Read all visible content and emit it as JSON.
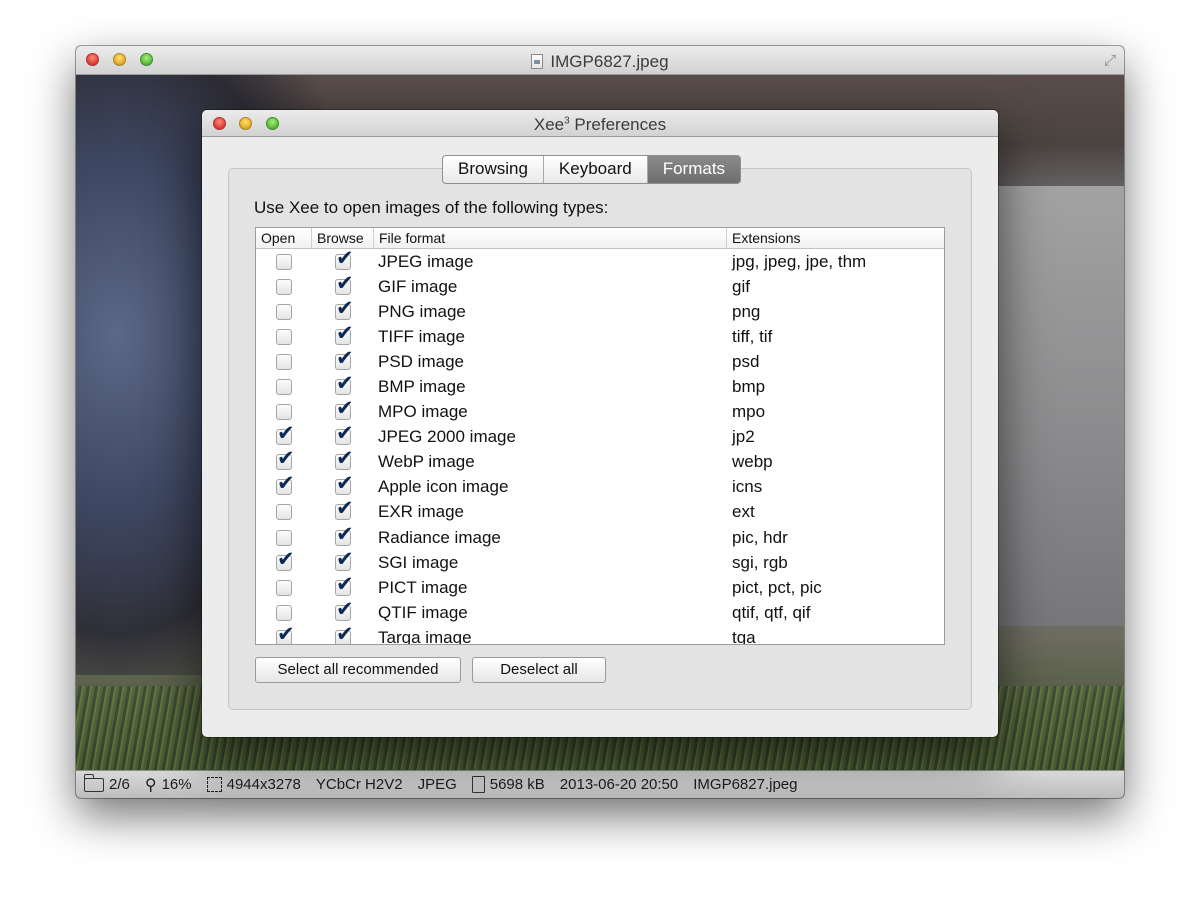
{
  "main_window": {
    "title": "IMGP6827.jpeg",
    "status": {
      "position": "2/6",
      "zoom": "16%",
      "dimensions": "4944x3278",
      "color_format": "YCbCr H2V2",
      "file_type": "JPEG",
      "file_size": "5698 kB",
      "date": "2013-06-20 20:50",
      "filename": "IMGP6827.jpeg"
    }
  },
  "prefs": {
    "title_main": "Xee",
    "title_sup": "3",
    "title_rest": " Preferences",
    "tabs": [
      {
        "label": "Browsing",
        "active": false
      },
      {
        "label": "Keyboard",
        "active": false
      },
      {
        "label": "Formats",
        "active": true
      }
    ],
    "intro": "Use Xee to open images of the following types:",
    "columns": {
      "open": "Open",
      "browse": "Browse",
      "format": "File format",
      "extensions": "Extensions"
    },
    "rows": [
      {
        "open": false,
        "browse": true,
        "format": "JPEG image",
        "ext": "jpg, jpeg, jpe, thm"
      },
      {
        "open": false,
        "browse": true,
        "format": "GIF image",
        "ext": "gif"
      },
      {
        "open": false,
        "browse": true,
        "format": "PNG image",
        "ext": "png"
      },
      {
        "open": false,
        "browse": true,
        "format": "TIFF image",
        "ext": "tiff, tif"
      },
      {
        "open": false,
        "browse": true,
        "format": "PSD image",
        "ext": "psd"
      },
      {
        "open": false,
        "browse": true,
        "format": "BMP image",
        "ext": "bmp"
      },
      {
        "open": false,
        "browse": true,
        "format": "MPO image",
        "ext": "mpo"
      },
      {
        "open": true,
        "browse": true,
        "format": "JPEG 2000 image",
        "ext": "jp2"
      },
      {
        "open": true,
        "browse": true,
        "format": "WebP image",
        "ext": "webp"
      },
      {
        "open": true,
        "browse": true,
        "format": "Apple icon image",
        "ext": "icns"
      },
      {
        "open": false,
        "browse": true,
        "format": "EXR image",
        "ext": "ext"
      },
      {
        "open": false,
        "browse": true,
        "format": "Radiance image",
        "ext": "pic, hdr"
      },
      {
        "open": true,
        "browse": true,
        "format": "SGI image",
        "ext": "sgi, rgb"
      },
      {
        "open": false,
        "browse": true,
        "format": "PICT image",
        "ext": "pict, pct, pic"
      },
      {
        "open": false,
        "browse": true,
        "format": "QTIF image",
        "ext": "qtif, qtf, qif"
      },
      {
        "open": true,
        "browse": true,
        "format": "Targa image",
        "ext": "tga"
      }
    ],
    "buttons": {
      "select_all": "Select all recommended",
      "deselect_all": "Deselect all"
    }
  },
  "colors": {
    "active_tab": "#7a7a7a",
    "check": "#0d2a57"
  }
}
